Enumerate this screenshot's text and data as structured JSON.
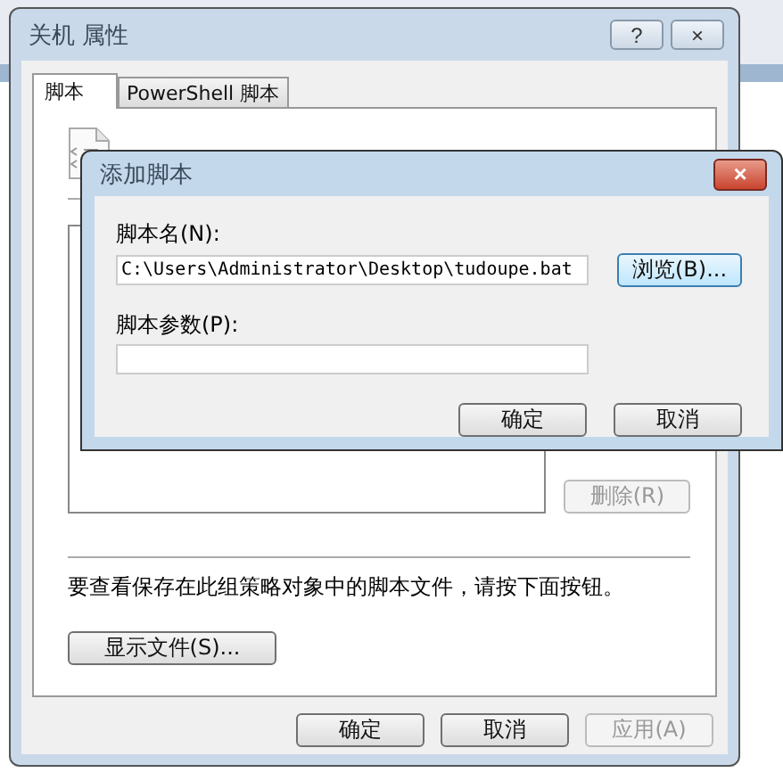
{
  "window": {
    "title": "关机 属性",
    "help_button": "?",
    "close_button": "×"
  },
  "tabs": [
    {
      "label": "脚本",
      "selected": true
    },
    {
      "label": "PowerShell 脚本",
      "selected": false
    }
  ],
  "panel": {
    "delete_button": {
      "label": "删除(R)",
      "disabled": true
    },
    "hint": "要查看保存在此组策略对象中的脚本文件，请按下面按钮。",
    "show_files_button": "显示文件(S)..."
  },
  "buttons": [
    {
      "label": "确定",
      "disabled": false
    },
    {
      "label": "取消",
      "disabled": false
    },
    {
      "label": "应用(A)",
      "disabled": true
    }
  ],
  "dialog": {
    "title": "添加脚本",
    "close_button": "×",
    "name_label": "脚本名(N):",
    "name_value": "C:\\Users\\Administrator\\Desktop\\tudoupe.bat",
    "browse_button": "浏览(B)...",
    "params_label": "脚本参数(P):",
    "buttons": [
      "确定",
      "取消"
    ]
  }
}
